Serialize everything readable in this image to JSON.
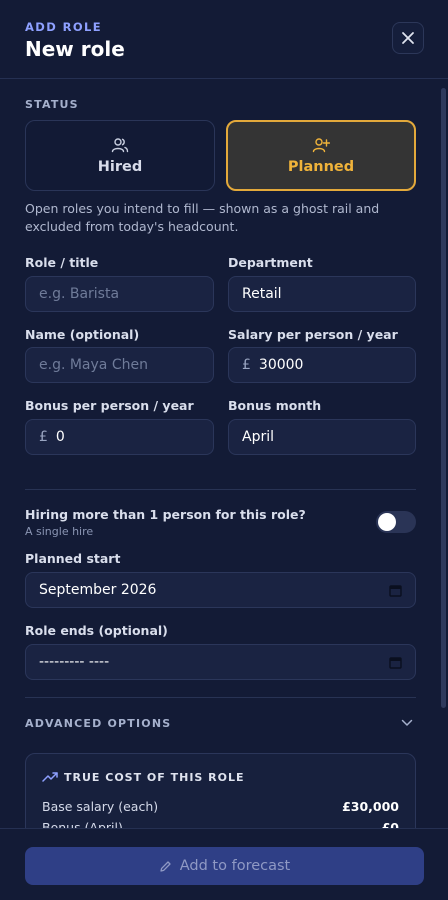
{
  "header": {
    "eyebrow": "ADD ROLE",
    "title": "New role",
    "close_icon": "close-icon"
  },
  "status": {
    "label": "STATUS",
    "options": [
      {
        "label": "Hired",
        "icon": "users-icon",
        "selected": false
      },
      {
        "label": "Planned",
        "icon": "user-plus-icon",
        "selected": true
      }
    ],
    "help": "Open roles you intend to fill — shown as a ghost rail and excluded from today's headcount."
  },
  "fields": {
    "role_title": {
      "label": "Role / title",
      "placeholder": "e.g. Barista",
      "value": ""
    },
    "department": {
      "label": "Department",
      "value": "Retail"
    },
    "name": {
      "label": "Name (optional)",
      "placeholder": "e.g. Maya Chen",
      "value": ""
    },
    "salary": {
      "label": "Salary per person / year",
      "currency": "£",
      "value": "30000"
    },
    "bonus": {
      "label": "Bonus per person / year",
      "currency": "£",
      "value": "0"
    },
    "bonus_month": {
      "label": "Bonus month",
      "value": "April"
    }
  },
  "hiring": {
    "question": "Hiring more than 1 person for this role?",
    "sub": "A single hire",
    "toggle_on": false
  },
  "planned_start": {
    "label": "Planned start",
    "value": "September 2026"
  },
  "role_ends": {
    "label": "Role ends (optional)",
    "value": "--------- ----"
  },
  "advanced": {
    "label": "ADVANCED OPTIONS"
  },
  "cost": {
    "title": "TRUE COST OF THIS ROLE",
    "rows": [
      {
        "label": "Base salary (each)",
        "value": "£30,000"
      },
      {
        "label": "Bonus (April)",
        "value": "£0"
      }
    ]
  },
  "footer": {
    "add_label": "Add to forecast"
  },
  "colors": {
    "accent": "#e3a93b",
    "primary": "#2f3f86",
    "background": "#131b36"
  }
}
